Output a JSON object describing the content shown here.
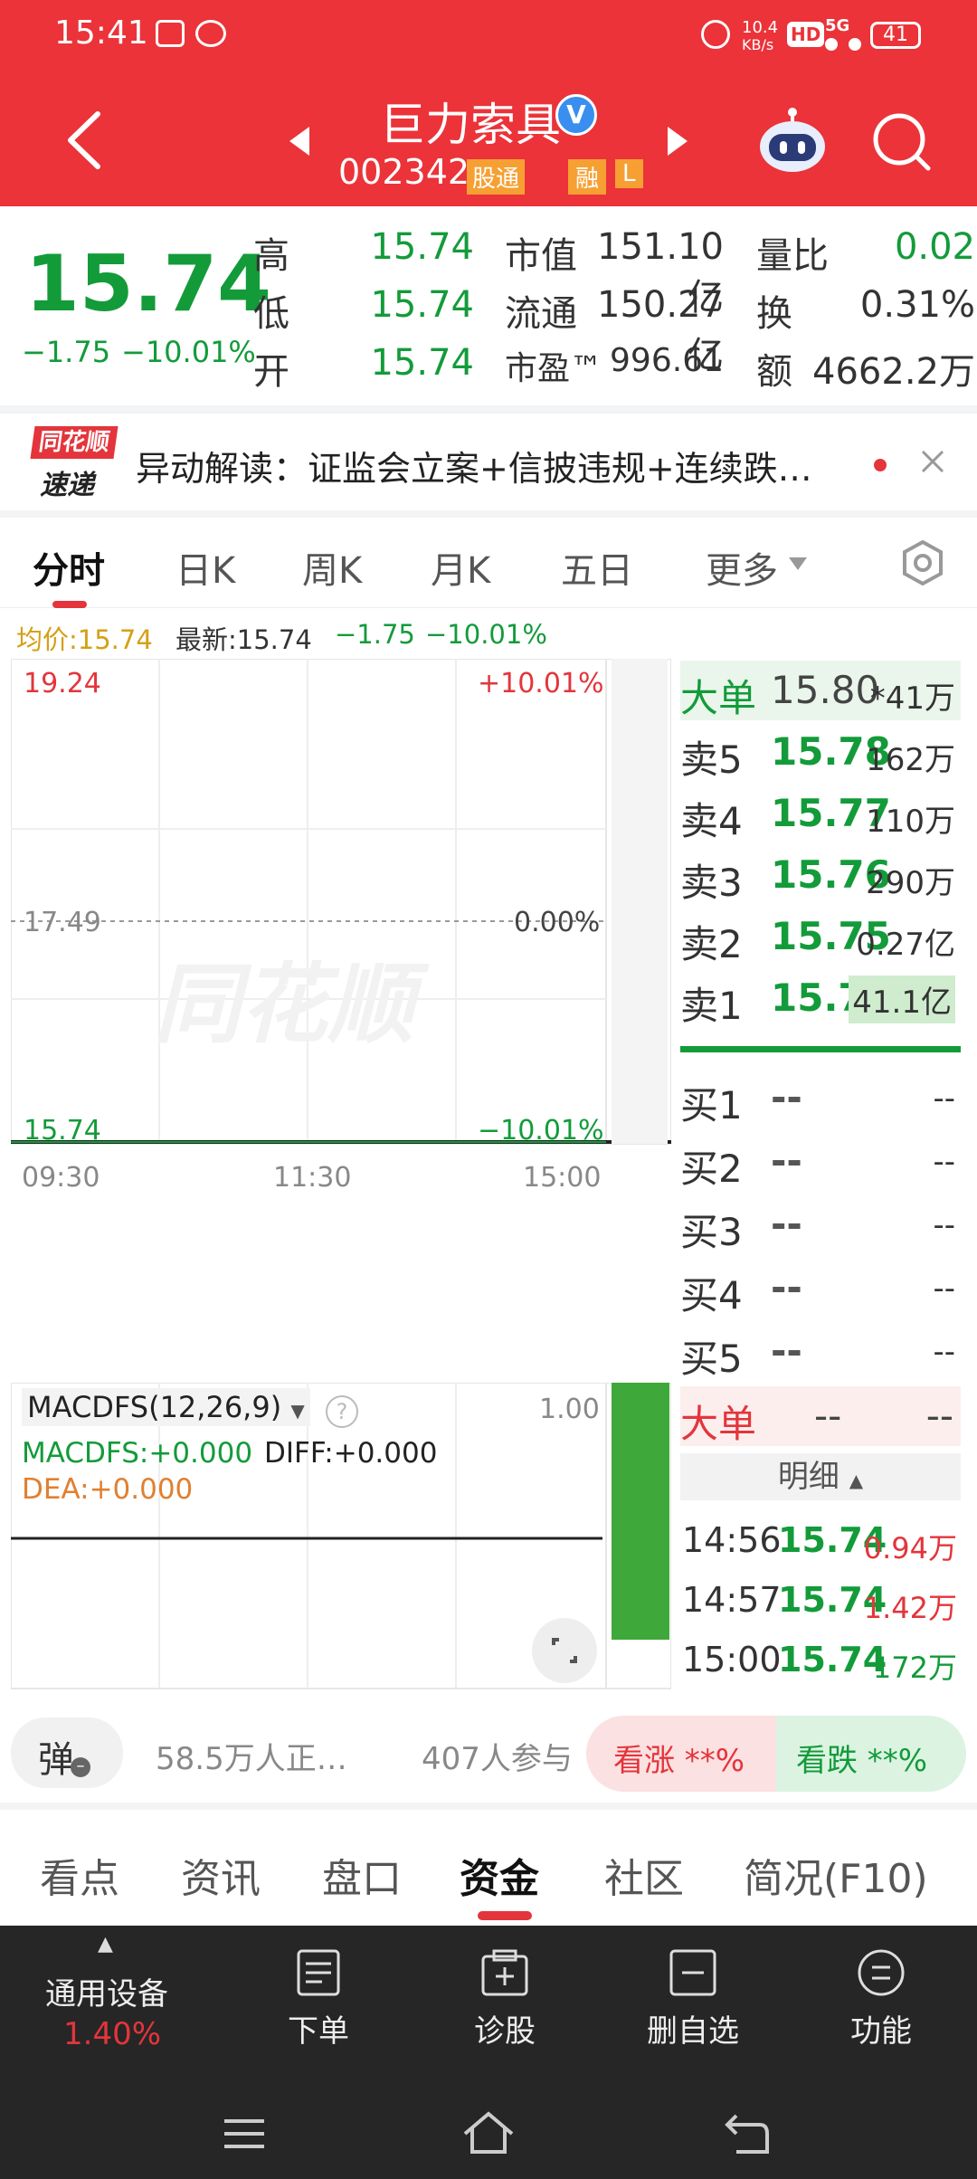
{
  "status_bar": {
    "time": "15:41",
    "network_speed_value": "10.4",
    "network_speed_unit": "KB/s",
    "hd": "HD",
    "signal": "5G",
    "battery": "41"
  },
  "header": {
    "stock_name": "巨力索具",
    "stock_code": "002342",
    "tag_connect": "股通",
    "tag_margin": "融",
    "tag_l": "L",
    "verified_badge": "V"
  },
  "quote": {
    "price": "15.74",
    "change": "−1.75",
    "change_pct": "−10.01%",
    "high_label": "高",
    "high": "15.74",
    "low_label": "低",
    "low": "15.74",
    "open_label": "开",
    "open": "15.74",
    "mktcap_label": "市值",
    "mktcap": "151.10亿",
    "float_label": "流通",
    "float": "150.27亿",
    "pe_label": "市盈™",
    "pe": "996.61",
    "vol_ratio_label": "量比",
    "vol_ratio": "0.02",
    "turnover_label": "换",
    "turnover": "0.31%",
    "amount_label": "额",
    "amount": "4662.2万"
  },
  "news": {
    "logo_top": "同花顺",
    "logo_bottom": "速递",
    "text": "异动解读：证监会立案+信披违规+连续跌…"
  },
  "tabs": [
    "分时",
    "日K",
    "周K",
    "月K",
    "五日",
    "更多"
  ],
  "chart_info": {
    "avg_label": "均价:15.74",
    "latest_label": "最新:15.74",
    "chg": "−1.75",
    "chg_pct": "−10.01%",
    "y_top": "19.24",
    "y_top_pct": "+10.01%",
    "y_mid": "17.49",
    "y_mid_pct": "0.00%",
    "y_bot": "15.74",
    "y_bot_pct": "−10.01%",
    "x_labels": [
      "09:30",
      "11:30",
      "15:00"
    ],
    "watermark": "同花顺"
  },
  "chart_data": {
    "type": "line",
    "title": "",
    "x": [
      "09:30",
      "11:30",
      "15:00"
    ],
    "series": [
      {
        "values": [
          15.74,
          15.74,
          15.74
        ]
      }
    ],
    "ylim": [
      15.74,
      19.24
    ],
    "ylabel": "",
    "xlabel": ""
  },
  "indicator": {
    "name": "MACDFS(12,26,9)",
    "top_value": "1.00",
    "macdfs": "MACDFS:+0.000",
    "diff": "DIFF:+0.000",
    "dea": "DEA:+0.000"
  },
  "orderbook": {
    "big_label": "大单",
    "big_price": "15.80",
    "big_vol": "*41万",
    "sells": [
      {
        "label": "卖5",
        "price": "15.78",
        "vol": "162万"
      },
      {
        "label": "卖4",
        "price": "15.77",
        "vol": "110万"
      },
      {
        "label": "卖3",
        "price": "15.76",
        "vol": "290万"
      },
      {
        "label": "卖2",
        "price": "15.75",
        "vol": "0.27亿"
      },
      {
        "label": "卖1",
        "price": "15.74",
        "vol": "41.1亿"
      }
    ],
    "buys": [
      {
        "label": "买1",
        "price": "--",
        "vol": "--"
      },
      {
        "label": "买2",
        "price": "--",
        "vol": "--"
      },
      {
        "label": "买3",
        "price": "--",
        "vol": "--"
      },
      {
        "label": "买4",
        "price": "--",
        "vol": "--"
      },
      {
        "label": "买5",
        "price": "--",
        "vol": "--"
      }
    ],
    "big2_label": "大单",
    "big2_price": "--",
    "big2_vol": "--",
    "detail_label": "明细",
    "trades": [
      {
        "time": "14:56",
        "price": "15.74",
        "vol": "0.94万"
      },
      {
        "time": "14:57",
        "price": "15.74",
        "vol": "1.42万"
      },
      {
        "time": "15:00",
        "price": "15.74",
        "vol": "172万"
      }
    ]
  },
  "sentiment": {
    "bullet_label": "弹",
    "watching": "58.5万人正…",
    "participants": "407人参与",
    "bull": "看涨 **%",
    "bear": "看跌 **%"
  },
  "bottom_tabs": [
    "看点",
    "资讯",
    "盘口",
    "资金",
    "社区",
    "简况(F10)"
  ],
  "bottom_nav": {
    "sector": "通用设备",
    "sector_pct": "1.40%",
    "items": [
      "下单",
      "诊股",
      "删自选",
      "功能"
    ]
  },
  "colors": {
    "header_red": "#eb3339",
    "down_green": "#139b3a",
    "up_red": "#e3353b"
  }
}
